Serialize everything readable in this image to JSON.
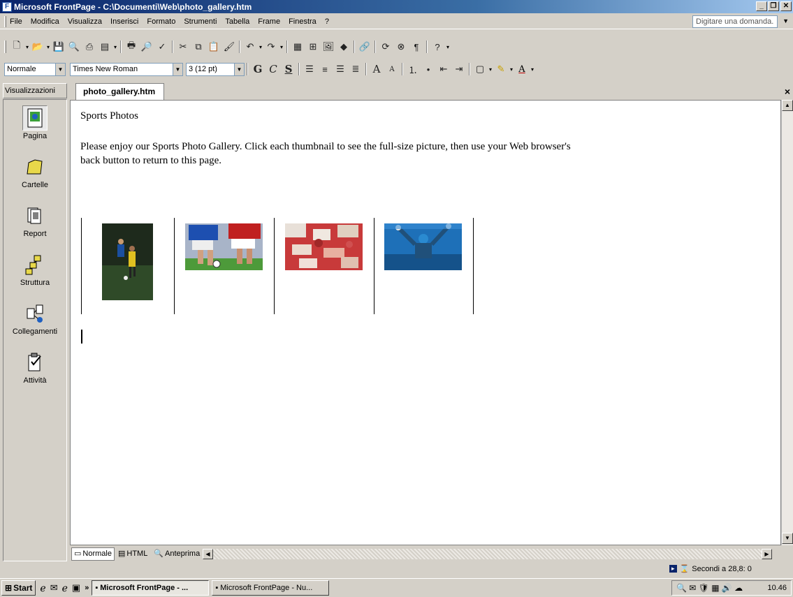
{
  "window": {
    "title": "Microsoft FrontPage - C:\\Documenti\\Web\\photo_gallery.htm"
  },
  "menu": [
    "File",
    "Modifica",
    "Visualizza",
    "Inserisci",
    "Formato",
    "Strumenti",
    "Tabella",
    "Frame",
    "Finestra",
    "?"
  ],
  "help_box": {
    "placeholder": "Digitare una domanda."
  },
  "format_toolbar": {
    "style": "Normale",
    "font": "Times New Roman",
    "size": "3 (12 pt)",
    "bold_label": "G",
    "italic_label": "C",
    "underline_label": "S"
  },
  "views_header": "Visualizzazioni",
  "views": [
    {
      "label": "Pagina",
      "icon": "page-view-icon"
    },
    {
      "label": "Cartelle",
      "icon": "folder-icon"
    },
    {
      "label": "Report",
      "icon": "report-icon"
    },
    {
      "label": "Struttura",
      "icon": "navigation-icon"
    },
    {
      "label": "Collegamenti",
      "icon": "hyperlinks-icon"
    },
    {
      "label": "Attività",
      "icon": "tasks-icon"
    }
  ],
  "document": {
    "tab": "photo_gallery.htm",
    "heading": "Sports Photos",
    "intro": "Please enjoy our Sports Photo Gallery. Click each thumbnail to see the full-size picture, then use your Web browser's back button to return to this page."
  },
  "view_modes": [
    "Normale",
    "HTML",
    "Anteprima"
  ],
  "status": {
    "text": "Secondi a 28,8: 0"
  },
  "taskbar": {
    "start": "Start",
    "tasks": [
      "Microsoft FrontPage - ...",
      "Microsoft FrontPage - Nu..."
    ],
    "clock": "10.46"
  }
}
